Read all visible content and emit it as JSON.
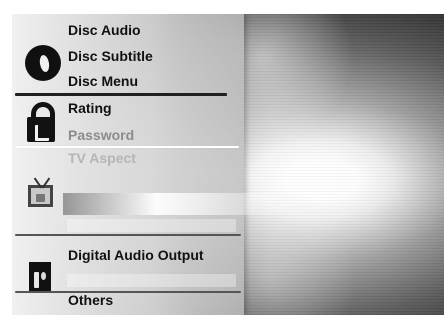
{
  "menu": {
    "groups": [
      {
        "icon": "disc-icon",
        "items": [
          "Disc Audio",
          "Disc Subtitle",
          "Disc Menu"
        ]
      },
      {
        "icon": "lock-icon",
        "items": [
          "Rating",
          "Password"
        ]
      },
      {
        "icon": "tv-icon",
        "items": [
          "TV Aspect"
        ]
      },
      {
        "icon": "digital-audio-icon",
        "items": [
          "Digital Audio Output"
        ]
      },
      {
        "items": [
          "Others"
        ]
      }
    ]
  }
}
